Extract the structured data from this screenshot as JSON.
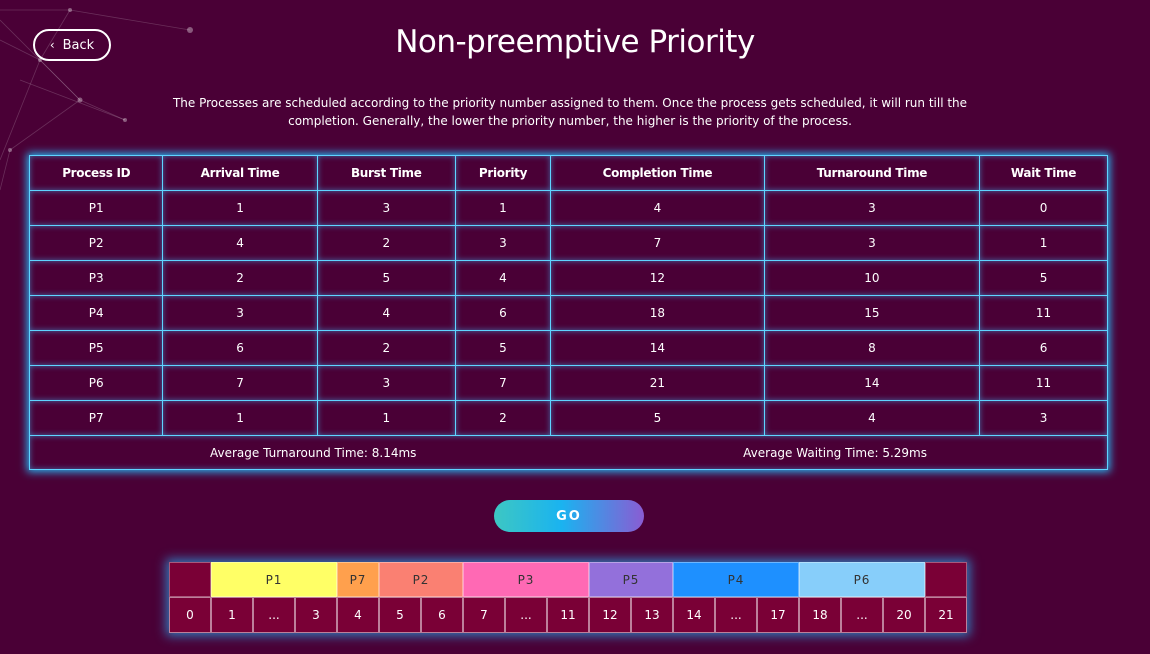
{
  "header": {
    "back_label": "Back",
    "title": "Non-preemptive Priority",
    "description": "The Processes are scheduled according to the priority number assigned to them. Once the process gets scheduled, it will run till the completion. Generally, the lower the priority number, the higher is the priority of the process."
  },
  "table": {
    "columns": [
      "Process ID",
      "Arrival Time",
      "Burst Time",
      "Priority",
      "Completion Time",
      "Turnaround Time",
      "Wait Time"
    ],
    "rows": [
      [
        "P1",
        "1",
        "3",
        "1",
        "4",
        "3",
        "0"
      ],
      [
        "P2",
        "4",
        "2",
        "3",
        "7",
        "3",
        "1"
      ],
      [
        "P3",
        "2",
        "5",
        "4",
        "12",
        "10",
        "5"
      ],
      [
        "P4",
        "3",
        "4",
        "6",
        "18",
        "15",
        "11"
      ],
      [
        "P5",
        "6",
        "2",
        "5",
        "14",
        "8",
        "6"
      ],
      [
        "P6",
        "7",
        "3",
        "7",
        "21",
        "14",
        "11"
      ],
      [
        "P7",
        "1",
        "1",
        "2",
        "5",
        "4",
        "3"
      ]
    ],
    "avg_turnaround": "Average Turnaround Time: 8.14ms",
    "avg_waiting": "Average Waiting Time: 5.29ms"
  },
  "go_label": "GO",
  "gantt": {
    "segments": [
      {
        "label": "",
        "span": 1,
        "color": "#7a0036"
      },
      {
        "label": "P1",
        "span": 3,
        "color": "#ffff66"
      },
      {
        "label": "P7",
        "span": 1,
        "color": "#ffa04d"
      },
      {
        "label": "P2",
        "span": 2,
        "color": "#fa8072"
      },
      {
        "label": "P3",
        "span": 3,
        "color": "#ff69b4"
      },
      {
        "label": "P5",
        "span": 2,
        "color": "#9370db"
      },
      {
        "label": "P4",
        "span": 3,
        "color": "#1e90ff"
      },
      {
        "label": "P6",
        "span": 3,
        "color": "#87cefa"
      },
      {
        "label": "",
        "span": 1,
        "color": "#7a0036"
      }
    ],
    "ticks": [
      "0",
      "1",
      "...",
      "3",
      "4",
      "5",
      "6",
      "7",
      "...",
      "11",
      "12",
      "13",
      "14",
      "...",
      "17",
      "18",
      "...",
      "20",
      "21"
    ]
  }
}
